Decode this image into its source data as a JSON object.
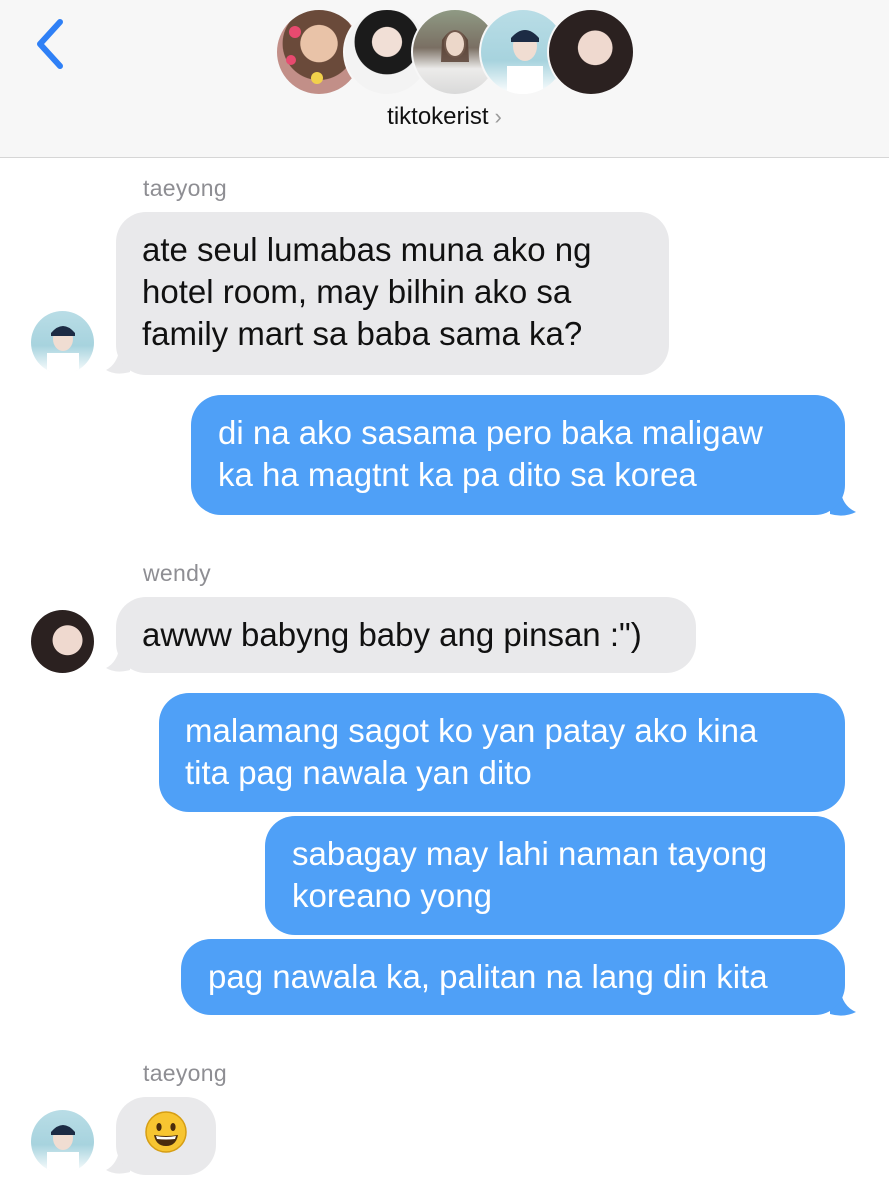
{
  "header": {
    "group_name": "tiktokerist",
    "chevron": "›",
    "back_icon": "chevron-left-icon",
    "accent_color": "#2f80f6"
  },
  "colors": {
    "incoming_bubble": "#e9e9eb",
    "outgoing_bubble": "#4fa0f7",
    "sender_label": "#8e8e93"
  },
  "messages": {
    "m1": {
      "sender": "taeyong",
      "lines": [
        "ate seul lumabas muna ako ng",
        "hotel room, may bilhin ako sa",
        "family mart sa baba sama ka?"
      ]
    },
    "m2": {
      "lines": [
        "di na ako sasama pero baka maligaw",
        "ka ha magtnt ka pa dito sa korea"
      ]
    },
    "m3": {
      "sender": "wendy",
      "lines": [
        "awww babyng baby ang pinsan :\")"
      ]
    },
    "m4": {
      "lines": [
        "malamang sagot ko yan patay ako kina",
        "tita pag nawala yan dito"
      ]
    },
    "m5": {
      "lines": [
        "sabagay may lahi naman tayong",
        "koreano yong"
      ]
    },
    "m6": {
      "lines": [
        "pag nawala ka, palitan na lang din kita"
      ]
    },
    "m7": {
      "sender": "taeyong",
      "emoji": "😀"
    }
  }
}
